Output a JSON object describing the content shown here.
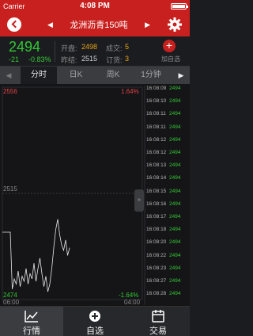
{
  "status_bar": {
    "carrier": "Carrier",
    "time": "4:08 PM",
    "battery_level": 0.9
  },
  "nav": {
    "title": "龙洲沥青150吨",
    "prev_arrow": "◀",
    "next_arrow": "▶"
  },
  "quote": {
    "price": "2494",
    "change": "-21",
    "change_pct": "-0.83%",
    "open_label": "开盘:",
    "open_value": "2498",
    "prev_close_label": "昨结:",
    "prev_close_value": "2515",
    "volume_label": "成交:",
    "volume_value": "5",
    "orders_label": "订货:",
    "orders_value": "3",
    "add_label": "加自选",
    "add_symbol": "+"
  },
  "tabs": {
    "left_arrow": "◀",
    "right_arrow": "▶",
    "items": [
      "分时",
      "日K",
      "周K",
      "1分钟"
    ],
    "active": "分时"
  },
  "chart": {
    "y_max_label": "2556",
    "y_mid_label": "2515",
    "y_min_label": "2474",
    "pct_max_label": "1.64%",
    "pct_min_label": "-1.64%",
    "x_start_label": "06:00",
    "x_end_label": "04:00",
    "collapse_symbol": "»"
  },
  "chart_data": {
    "type": "line",
    "ylim": [
      2474,
      2556
    ],
    "baseline": 2515,
    "x_range": [
      "06:00",
      "04:00"
    ],
    "series": [
      {
        "values": [
          2500,
          2500,
          2500,
          2500,
          2500,
          2478,
          2482,
          2480,
          2485,
          2479,
          2483,
          2481,
          2486,
          2480,
          2484,
          2482,
          2488,
          2481,
          2486,
          2490,
          2484,
          2479,
          2483,
          2477,
          2480,
          2486,
          2494,
          2501,
          2505,
          2499,
          2495,
          2493,
          2497,
          2491,
          2494
        ]
      }
    ]
  },
  "ticks": [
    [
      "16:08:09",
      "2494"
    ],
    [
      "16:08:10",
      "2494"
    ],
    [
      "16:08:11",
      "2494"
    ],
    [
      "16:08:11",
      "2494"
    ],
    [
      "16:08:12",
      "2494"
    ],
    [
      "16:08:12",
      "2494"
    ],
    [
      "16:08:13",
      "2494"
    ],
    [
      "16:08:14",
      "2494"
    ],
    [
      "16:08:15",
      "2494"
    ],
    [
      "16:08:16",
      "2494"
    ],
    [
      "16:08:17",
      "2494"
    ],
    [
      "16:08:18",
      "2494"
    ],
    [
      "16:08:20",
      "2494"
    ],
    [
      "16:08:22",
      "2494"
    ],
    [
      "16:08:23",
      "2494"
    ],
    [
      "16:08:27",
      "2494"
    ],
    [
      "16:08:28",
      "2494"
    ]
  ],
  "tabbar": {
    "items": [
      {
        "label": "行情",
        "icon": "chart-icon"
      },
      {
        "label": "自选",
        "icon": "plus-circle-icon"
      },
      {
        "label": "交易",
        "icon": "calendar-icon"
      }
    ],
    "active": "行情"
  },
  "colors": {
    "brand_red": "#c8201e",
    "down_green": "#32c832",
    "up_red": "#e24444",
    "value_orange": "#e6a417",
    "background": "#1b1c20"
  }
}
